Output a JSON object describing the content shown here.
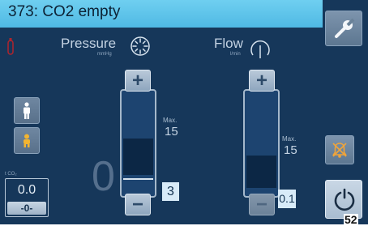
{
  "header": {
    "title": "373: CO2 empty"
  },
  "pressure": {
    "label": "Pressure",
    "unit": "mmHg",
    "max_label": "Max.",
    "max_value": "15",
    "setpoint": "3",
    "current_value": "0",
    "plus_label": "+",
    "minus_label": "−"
  },
  "flow": {
    "label": "Flow",
    "unit": "l/min",
    "max_label": "Max.",
    "max_value": "15",
    "setpoint": "0.1",
    "plus_label": "+",
    "minus_label": "−"
  },
  "tco2": {
    "label": "t CO₂",
    "value": "0.0",
    "reset_label": "-0-"
  },
  "footer": {
    "corner_number": "52"
  },
  "colors": {
    "background": "#16375a",
    "title_bar": "#5cc4ec",
    "setpoint_box": "#d8ebf8",
    "alarm_icon": "#f0a43a",
    "indicator": "#b0242c"
  },
  "icons": [
    "co2-cylinder-icon",
    "wrench-icon",
    "pressure-dial-icon",
    "flow-dial-icon",
    "adult-patient-icon",
    "child-patient-icon",
    "alarm-muted-icon",
    "power-icon"
  ]
}
